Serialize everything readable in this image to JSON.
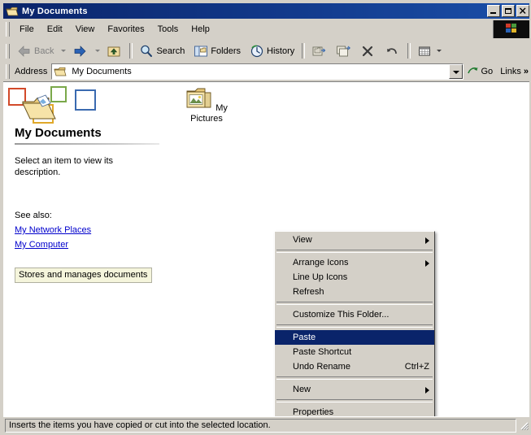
{
  "window": {
    "title": "My Documents",
    "icon": "folder-icon",
    "caption_buttons": [
      {
        "name": "minimize-button",
        "glyph": "_"
      },
      {
        "name": "maximize-button",
        "glyph": "□"
      },
      {
        "name": "close-button",
        "glyph": "×"
      }
    ]
  },
  "menubar": {
    "items": [
      {
        "label": "File"
      },
      {
        "label": "Edit"
      },
      {
        "label": "View"
      },
      {
        "label": "Favorites"
      },
      {
        "label": "Tools"
      },
      {
        "label": "Help"
      }
    ],
    "logo": "windows-flag-logo"
  },
  "toolbar": {
    "back_label": "Back",
    "search_label": "Search",
    "folders_label": "Folders",
    "history_label": "History",
    "icons": {
      "back": "back-arrow-icon",
      "forward": "forward-arrow-icon",
      "up": "up-one-level-icon",
      "search": "magnifier-icon",
      "folders": "folder-pane-icon",
      "history": "history-clock-icon",
      "move_to": "move-to-folder-icon",
      "copy_to": "copy-to-folder-icon",
      "delete": "delete-x-icon",
      "undo": "undo-arrow-icon",
      "views": "views-grid-icon"
    }
  },
  "address": {
    "label": "Address",
    "value": "My Documents",
    "icon": "folder-icon",
    "go_label": "Go",
    "go_icon": "go-arrow-icon",
    "links_label": "Links",
    "links_chevron": "»",
    "dropdown_icon": "chevron-down-icon"
  },
  "sidebar": {
    "heading": "My Documents",
    "description": "Select an item to view its description.",
    "tooltip": "Stores and manages documents",
    "see_also_label": "See also:",
    "links": [
      {
        "label": "My Network Places"
      },
      {
        "label": "My Computer"
      }
    ]
  },
  "files": [
    {
      "label": "My Pictures",
      "icon": "pictures-folder-icon"
    }
  ],
  "context_menu": {
    "items": [
      {
        "label": "View",
        "submenu": true,
        "accel": "",
        "selected": false,
        "separator_after": true
      },
      {
        "label": "Arrange Icons",
        "submenu": true,
        "accel": "",
        "selected": false,
        "separator_after": false
      },
      {
        "label": "Line Up Icons",
        "submenu": false,
        "accel": "",
        "selected": false,
        "separator_after": false
      },
      {
        "label": "Refresh",
        "submenu": false,
        "accel": "",
        "selected": false,
        "separator_after": true
      },
      {
        "label": "Customize This Folder...",
        "submenu": false,
        "accel": "",
        "selected": false,
        "separator_after": true
      },
      {
        "label": "Paste",
        "submenu": false,
        "accel": "",
        "selected": true,
        "separator_after": false
      },
      {
        "label": "Paste Shortcut",
        "submenu": false,
        "accel": "",
        "selected": false,
        "separator_after": false
      },
      {
        "label": "Undo Rename",
        "submenu": false,
        "accel": "Ctrl+Z",
        "selected": false,
        "separator_after": true
      },
      {
        "label": "New",
        "submenu": true,
        "accel": "",
        "selected": false,
        "separator_after": true
      },
      {
        "label": "Properties",
        "submenu": false,
        "accel": "",
        "selected": false,
        "separator_after": false
      }
    ]
  },
  "statusbar": {
    "text": "Inserts the items you have copied or cut into the selected location."
  },
  "colors": {
    "titlebar_start": "#0a246a",
    "titlebar_end": "#1b4fa8",
    "face": "#d4d0c8",
    "highlight": "#0a246a",
    "link": "#0000cc",
    "tooltip_bg": "#f5f5dc"
  }
}
